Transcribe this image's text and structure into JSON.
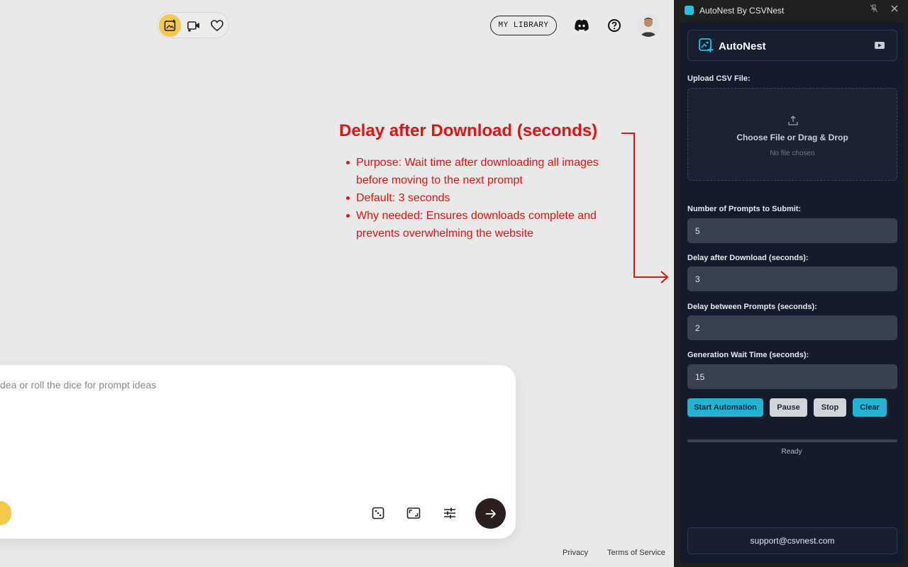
{
  "webapp": {
    "modes": [
      {
        "icon": "image-spark-icon",
        "active": true
      },
      {
        "icon": "video-spark-icon",
        "active": false
      },
      {
        "icon": "heart-icon",
        "active": false
      }
    ],
    "library_label": "MY LIBRARY",
    "prompt_placeholder": "dea or roll the dice for prompt ideas",
    "footer": {
      "privacy": "Privacy",
      "terms": "Terms of Service"
    },
    "accent_color": "#f7c948"
  },
  "annotation": {
    "title": "Delay after Download (seconds)",
    "bullets": [
      "Purpose: Wait time after downloading all images before moving to the next prompt",
      "Default: 3 seconds",
      "Why needed: Ensures downloads complete and prevents overwhelming the website"
    ],
    "color": "#e11313"
  },
  "extension": {
    "window_title": "AutoNest By CSVNest",
    "brand": "AutoNest",
    "upload_label": "Upload CSV File:",
    "dropzone_text": "Choose File or Drag & Drop",
    "dropzone_status": "No file chosen",
    "fields": [
      {
        "label": "Number of Prompts to Submit:",
        "value": "5"
      },
      {
        "label": "Delay after Download (seconds):",
        "value": "3"
      },
      {
        "label": "Delay between Prompts (seconds):",
        "value": "2"
      },
      {
        "label": "Generation Wait Time (seconds):",
        "value": "15"
      }
    ],
    "buttons": {
      "start": "Start Automation",
      "pause": "Pause",
      "stop": "Stop",
      "clear": "Clear"
    },
    "progress": 0,
    "status": "Ready",
    "support": "support@csvnest.com",
    "accent_color": "#22c3e6"
  }
}
